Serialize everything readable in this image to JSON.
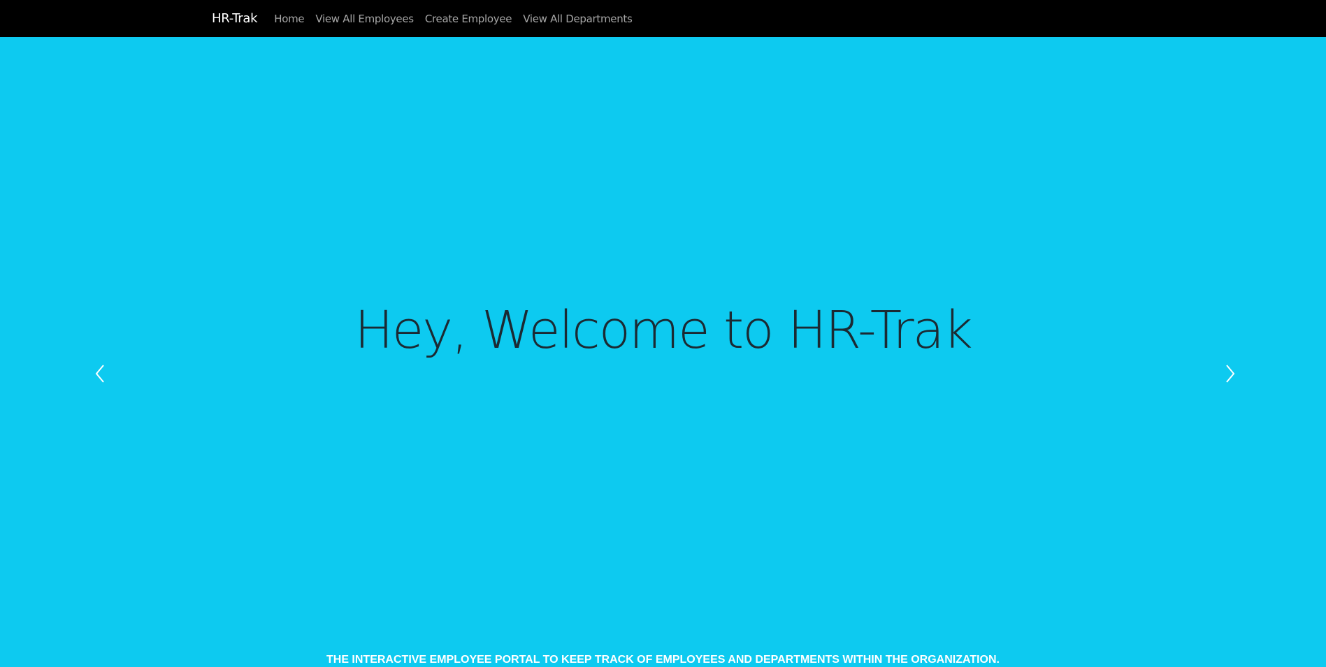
{
  "navbar": {
    "brand": "HR-Trak",
    "links": [
      {
        "label": "Home"
      },
      {
        "label": "View All Employees"
      },
      {
        "label": "Create Employee"
      },
      {
        "label": "View All Departments"
      }
    ]
  },
  "hero": {
    "title": "Hey, Welcome to HR-Trak",
    "tagline": "THE INTERACTIVE EMPLOYEE PORTAL TO KEEP TRACK OF EMPLOYEES AND DEPARTMENTS WITHIN THE ORGANIZATION.",
    "prev_icon": "chevron-left-icon",
    "next_icon": "chevron-right-icon"
  },
  "colors": {
    "navbar_bg": "#000000",
    "hero_bg": "#0dcaf0",
    "title_text": "#1b2a33",
    "nav_link": "#a6a6a6"
  }
}
